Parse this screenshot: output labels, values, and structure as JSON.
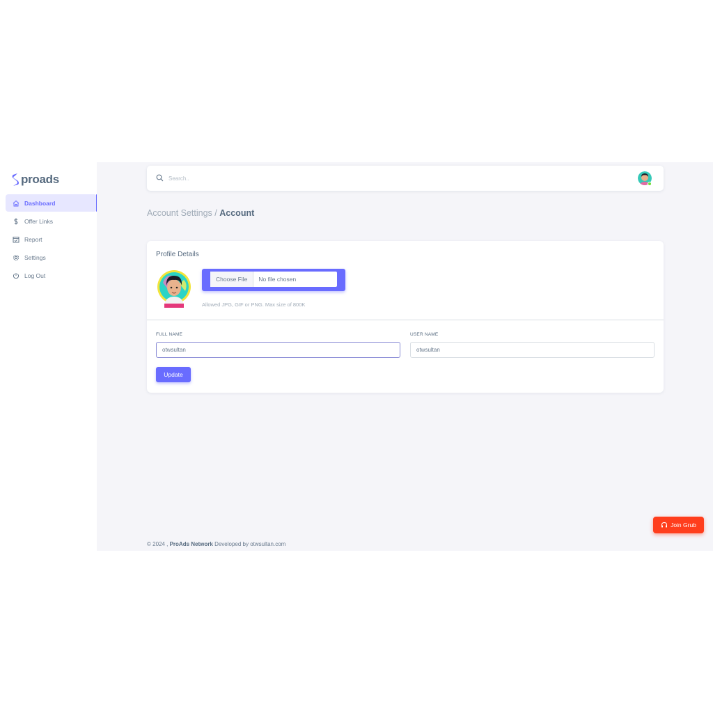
{
  "brand": {
    "name": "proads",
    "color": "#696cff"
  },
  "sidebar": {
    "items": [
      {
        "label": "Dashboard",
        "icon": "home-icon",
        "active": true
      },
      {
        "label": "Offer Links",
        "icon": "dollar-icon"
      },
      {
        "label": "Report",
        "icon": "report-icon"
      },
      {
        "label": "Settings",
        "icon": "gear-icon"
      },
      {
        "label": "Log Out",
        "icon": "power-icon"
      }
    ]
  },
  "topbar": {
    "search_placeholder": "Search.."
  },
  "breadcrumb": {
    "parent": "Account Settings /",
    "current": "Account"
  },
  "profile": {
    "title": "Profile Details",
    "file_button": "Choose File",
    "file_status": "No file chosen",
    "hint": "Allowed JPG, GIF or PNG. Max size of 800K"
  },
  "form": {
    "full_name_label": "FULL NAME",
    "full_name_value": "otwsultan",
    "user_name_label": "USER NAME",
    "user_name_value": "otwsultan",
    "update_label": "Update"
  },
  "footer": {
    "prefix": "© 2024 ,",
    "brand": "ProAds Network",
    "suffix": "Developed by otwsultan.com"
  },
  "join_button": {
    "label": "Join Grub",
    "icon": "headset-icon",
    "color": "#ff3e1d"
  }
}
